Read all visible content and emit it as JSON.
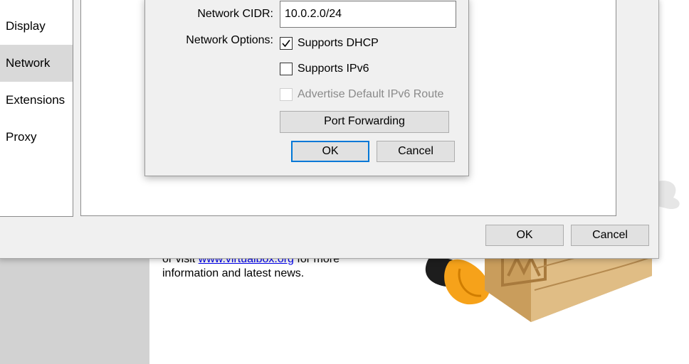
{
  "background": {
    "text_prefix": "or visit ",
    "link": "www.virtualbox.org",
    "text_suffix": " for more",
    "line2": "information and latest news."
  },
  "settings": {
    "sidebar": {
      "items": [
        {
          "label": "Display"
        },
        {
          "label": "Network",
          "selected": true
        },
        {
          "label": "Extensions"
        },
        {
          "label": "Proxy"
        }
      ]
    },
    "ok_label": "OK",
    "cancel_label": "Cancel"
  },
  "nat_dialog": {
    "cidr_label": "Network CIDR:",
    "cidr_value": "10.0.2.0/24",
    "options_label": "Network Options:",
    "options": [
      {
        "label": "Supports DHCP",
        "checked": true,
        "enabled": true
      },
      {
        "label": "Supports IPv6",
        "checked": false,
        "enabled": true
      },
      {
        "label": "Advertise Default IPv6 Route",
        "checked": false,
        "enabled": false
      }
    ],
    "port_forwarding_label": "Port Forwarding",
    "ok_label": "OK",
    "cancel_label": "Cancel"
  },
  "colors": {
    "accent": "#0078d7",
    "link": "#0000ee"
  }
}
